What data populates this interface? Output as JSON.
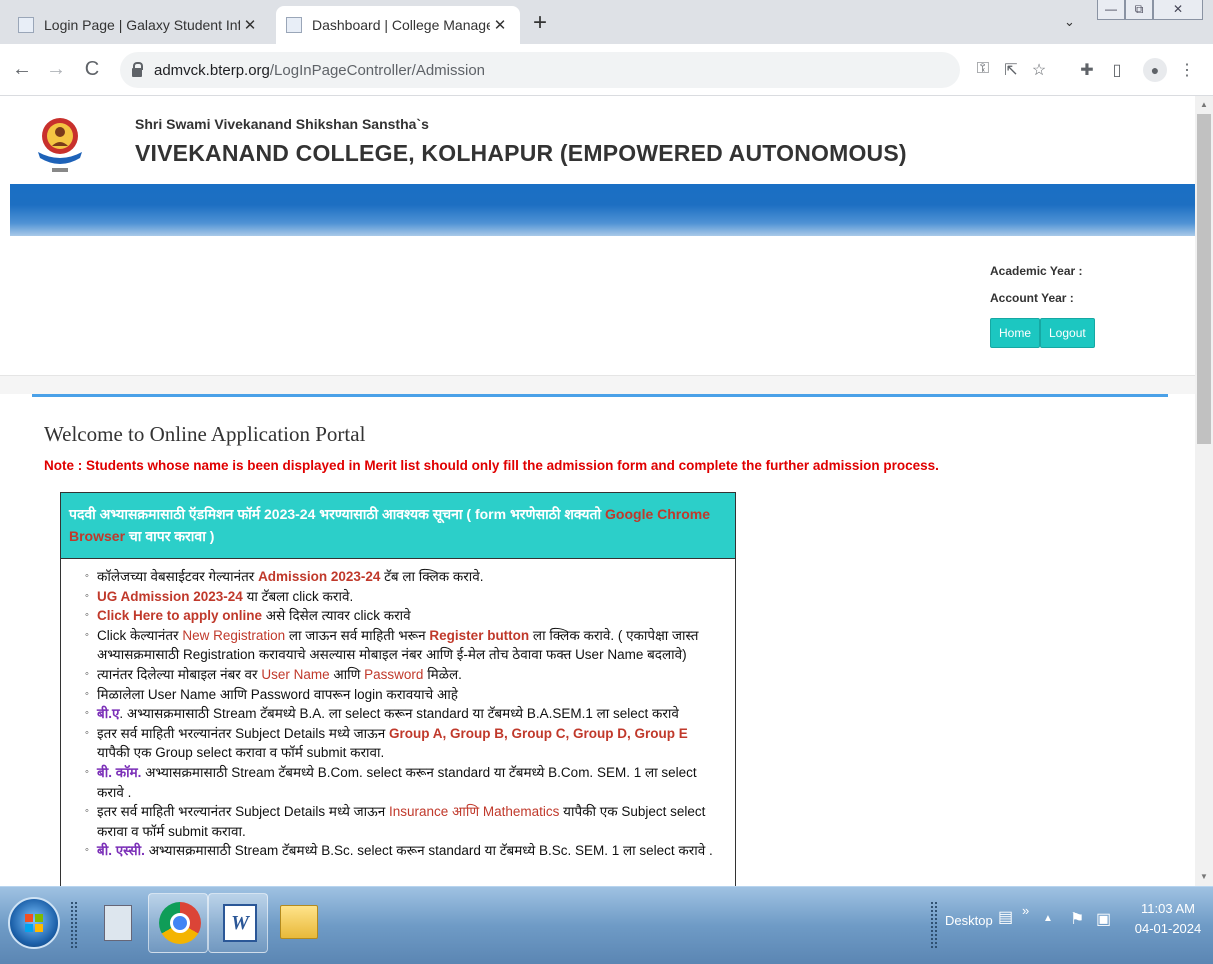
{
  "browser": {
    "tabs": [
      {
        "title": "Login Page | Galaxy Student Infor",
        "active": false
      },
      {
        "title": "Dashboard | College Managemen",
        "active": true
      }
    ],
    "new_tab": "+",
    "tab_search": "⌄",
    "url_host": "admvck.bterp.org",
    "url_path": "/LogInPageController/Admission",
    "window_buttons": [
      "—",
      "⧉",
      "✕"
    ]
  },
  "header": {
    "sanstha": "Shri Swami Vivekanand Shikshan Sanstha`s",
    "college": "VIVEKANAND COLLEGE, KOLHAPUR (EMPOWERED AUTONOMOUS)"
  },
  "info": {
    "academic_year": "Academic Year :",
    "account_year": "Account Year  :",
    "home": "Home",
    "logout": "Logout"
  },
  "welcome": "Welcome to Online Application Portal",
  "note": "Note : Students whose name is been displayed in Merit list should only fill the admission form and complete the further admission process.",
  "instructions": {
    "head_1": "पदवी अभ्यासक्रमासाठी ऍडमिशन फॉर्म 2023-24 भरण्यासाठी आवश्यक सूचना ( form भरणेसाठी शक्यतो ",
    "head_red": "Google Chrome Browser",
    "head_2": " चा वापर  करावा )",
    "items": [
      {
        "a": "कॉलेजच्या वेबसाईटवर गेल्यानंतर  ",
        "b": "Admission 2023-24",
        "c": " टॅब ला क्लिक करावे."
      },
      {
        "a": "",
        "b": "UG Admission 2023-24",
        "c": " या टॅबला click करावे."
      },
      {
        "a": "",
        "b": "Click Here to apply online",
        "c": " असे दिसेल त्यावर click करावे"
      },
      {
        "a": "Click केल्यानंतर ",
        "b": "New Registration",
        "c": " ला जाऊन  सर्व माहिती भरून  ",
        "d": "Register button",
        "e": " ला क्लिक करावे. ( एकापेक्षा जास्त अभ्यासक्रमासाठी Registration करावयाचे असल्यास मोबाइल नंबर  आणि ई-मेल तोच ठेवावा फक्त User Name बदलावे)"
      },
      {
        "a": "त्यानंतर दिलेल्या मोबाइल नंबर वर ",
        "b": "User Name",
        "c": " आणि ",
        "d": "Password",
        "e": " मिळेल."
      },
      {
        "a": "मिळालेला User Name आणि Password वापरून login करावयाचे आहे"
      },
      {
        "a": "",
        "b": "बी.ए",
        "c": ". अभ्यासक्रमासाठी Stream टॅबमध्ये B.A. ला  select करून standard या टॅबमध्ये B.A.SEM.1 ला select करावे"
      },
      {
        "a": "इतर सर्व माहिती भरल्यानंतर Subject Details मध्ये जाऊन ",
        "b": "Group A, Group B, Group C, Group D, Group E",
        "c": " यापैकी एक Group select करावा व फॉर्म submit करावा."
      },
      {
        "a": "",
        "b": "बी. कॉम.",
        "c": " अभ्यासक्रमासाठी Stream टॅबमध्ये B.Com. select करून standard या टॅबमध्ये B.Com. SEM. 1 ला select करावे ."
      },
      {
        "a": "इतर सर्व माहिती भरल्यानंतर Subject Details मध्ये जाऊन ",
        "b": "Insurance आणि Mathematics",
        "c": " यापैकी एक Subject select करावा व फॉर्म submit करावा."
      },
      {
        "a": "",
        "b": "बी. एस्सी.",
        "c": " अभ्यासक्रमासाठी Stream टॅबमध्ये B.Sc. select करून standard या टॅबमध्ये B.Sc. SEM. 1 ला select करावे ."
      }
    ]
  },
  "taskbar": {
    "desktop": "Desktop",
    "time": "11:03 AM",
    "date": "04-01-2024"
  }
}
